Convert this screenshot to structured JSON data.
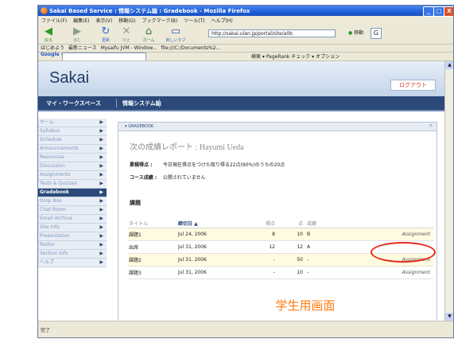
{
  "window": {
    "title": "Sakai Based Service : 情報システム論 : Gradebook - Mozilla Firefox",
    "buttons": [
      "_",
      "□",
      "X"
    ]
  },
  "menu": [
    "ファイル(F)",
    "編集(E)",
    "表示(V)",
    "移動(G)",
    "ブックマーク(B)",
    "ツール(T)",
    "ヘルプ(H)"
  ],
  "toolbar": {
    "buttons": [
      {
        "label": "戻る",
        "glyph": "◀"
      },
      {
        "label": "進む",
        "glyph": "▶"
      },
      {
        "label": "更新",
        "glyph": "↻"
      },
      {
        "label": "中止",
        "glyph": "✕"
      },
      {
        "label": "ホーム",
        "glyph": "⌂"
      },
      {
        "label": "新しいタブ",
        "glyph": "▭"
      }
    ],
    "url": "http://sakai.ulan.jp/portal/site/a0b",
    "go_label": "移動"
  },
  "bookmarks": [
    "はじめよう",
    "最新ニュース",
    "Mysaifu JVM - Window...",
    "file:///C:/Documents%2..."
  ],
  "google_bar": {
    "logo": "Google -",
    "right_text": "検索 ▾  PageRank  チェック ▾  オプション"
  },
  "sakai": {
    "logo": "Sakai",
    "logout": "ログアウト",
    "sites": [
      "マイ・ワークスペース",
      "情報システム論"
    ],
    "tools": [
      "ホーム",
      "Syllabus",
      "Schedule",
      "Announcements",
      "Resources",
      "Discussion",
      "Assignments",
      "Tests & Quizzes",
      "Gradebook",
      "Drop Box",
      "Chat Room",
      "Email Archive",
      "Site Info",
      "Presentation",
      "Roster",
      "Section Info",
      "ヘルプ"
    ],
    "active_tool": "Gradebook"
  },
  "gradebook": {
    "title_bar": "GRADEBOOK",
    "help": "?",
    "heading": "次の成績レポート : Hayumi Ueda",
    "points_label": "累積得点 :",
    "points_value": "今日現在得点をつけた取り得る22点(90%)のうちの20点",
    "grade_label": "コース成績 :",
    "grade_value": "公開されていません",
    "section_label": "課題",
    "columns": [
      "タイトル",
      "締切日 ▲",
      "得点",
      "点",
      "成績",
      ""
    ],
    "rows": [
      [
        "課題1",
        "Jul 24, 2006",
        "8",
        "10",
        "B",
        "Assignment"
      ],
      [
        "出席",
        "Jul 31, 2006",
        "12",
        "12",
        "A",
        ""
      ],
      [
        "課題2",
        "Jul 31, 2006",
        "-",
        "50",
        "-",
        "Assignment"
      ],
      [
        "課題3",
        "Jul 31, 2006",
        "-",
        "10",
        "-",
        "Assignment"
      ]
    ]
  },
  "status": "完了",
  "overlay": {
    "label": "学生用画面"
  }
}
